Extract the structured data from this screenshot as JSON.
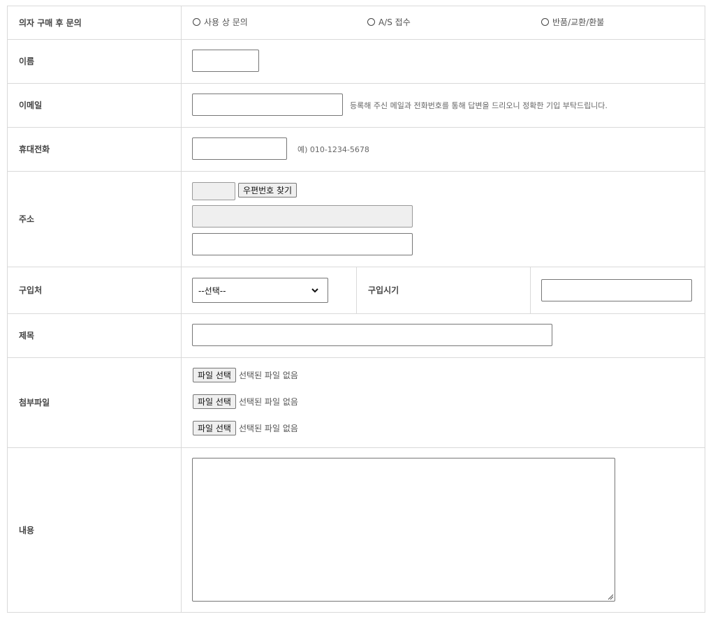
{
  "form": {
    "inquiry_type": {
      "label": "의자 구매 후 문의",
      "options": [
        "사용 상 문의",
        "A/S 접수",
        "반품/교환/환불"
      ]
    },
    "name": {
      "label": "이름"
    },
    "email": {
      "label": "이메일",
      "hint": "등록해 주신 메일과 전화번호를 통해 답변을 드리오니 정확한 기입 부탁드립니다."
    },
    "phone": {
      "label": "휴대전화",
      "hint": "예) 010-1234-5678"
    },
    "address": {
      "label": "주소",
      "zip_button": "우편번호 찾기"
    },
    "purchase_place": {
      "label": "구입처",
      "selected": "--선택--"
    },
    "purchase_date": {
      "label": "구입시기"
    },
    "subject": {
      "label": "제목"
    },
    "attachments": {
      "label": "첨부파일",
      "items": [
        {
          "button": "파일 선택",
          "status": "선택된 파일 없음"
        },
        {
          "button": "파일 선택",
          "status": "선택된 파일 없음"
        },
        {
          "button": "파일 선택",
          "status": "선택된 파일 없음"
        }
      ]
    },
    "content": {
      "label": "내용"
    }
  },
  "colors": {
    "border": "#d9d9d9",
    "input_border": "#767676",
    "readonly_bg": "#efefef"
  }
}
